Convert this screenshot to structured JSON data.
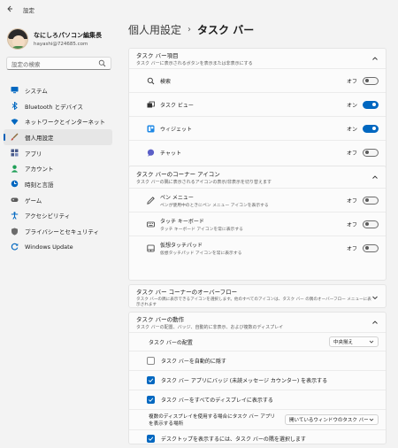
{
  "window": {
    "title": "設定",
    "back_icon": "back-arrow-icon"
  },
  "profile": {
    "name": "なにしろパソコン編集長",
    "email": "hayashi@724685.com"
  },
  "search": {
    "placeholder": "設定の検索",
    "icon": "search-icon"
  },
  "sidebar": {
    "items": [
      {
        "label": "システム",
        "icon": "monitor-icon",
        "color": "#0067c0",
        "active": false
      },
      {
        "label": "Bluetooth とデバイス",
        "icon": "bluetooth-icon",
        "color": "#0067c0",
        "active": false
      },
      {
        "label": "ネットワークとインターネット",
        "icon": "wifi-icon",
        "color": "#0067c0",
        "active": false
      },
      {
        "label": "個人用設定",
        "icon": "brush-icon",
        "color": "#8a6b3c",
        "active": true
      },
      {
        "label": "アプリ",
        "icon": "apps-icon",
        "color": "#4a5b8a",
        "active": false
      },
      {
        "label": "アカウント",
        "icon": "person-icon",
        "color": "#1f9f57",
        "active": false
      },
      {
        "label": "時刻と言語",
        "icon": "globe-clock-icon",
        "color": "#0067c0",
        "active": false
      },
      {
        "label": "ゲーム",
        "icon": "gamepad-icon",
        "color": "#5a5a5a",
        "active": false
      },
      {
        "label": "アクセシビリティ",
        "icon": "accessibility-icon",
        "color": "#0067c0",
        "active": false
      },
      {
        "label": "プライバシーとセキュリティ",
        "icon": "shield-icon",
        "color": "#6b6b6b",
        "active": false
      },
      {
        "label": "Windows Update",
        "icon": "update-icon",
        "color": "#0067c0",
        "active": false
      }
    ]
  },
  "breadcrumb": {
    "parent": "個人用設定",
    "separator": "›",
    "current": "タスク バー"
  },
  "sections": {
    "items": {
      "title": "タスク バー項目",
      "subtitle": "タスク バーに表示されるボタンを表示または非表示にする",
      "rows": [
        {
          "label": "検索",
          "icon": "search-icon",
          "state": "オフ",
          "on": false
        },
        {
          "label": "タスク ビュー",
          "icon": "task-view-icon",
          "state": "オン",
          "on": true
        },
        {
          "label": "ウィジェット",
          "icon": "widgets-icon",
          "state": "オン",
          "on": true
        },
        {
          "label": "チャット",
          "icon": "chat-icon",
          "state": "オフ",
          "on": false
        }
      ]
    },
    "corner": {
      "title": "タスク バーのコーナー アイコン",
      "subtitle": "タスク バーの隅に表示されるアイコンの表示/非表示を切り替えます",
      "rows": [
        {
          "label": "ペン メニュー",
          "sub": "ペンが使用中のときにペン メニュー アイコンを表示する",
          "icon": "pen-icon",
          "state": "オフ",
          "on": false
        },
        {
          "label": "タッチ キーボード",
          "sub": "タッチ キーボード アイコンを常に表示する",
          "icon": "keyboard-icon",
          "state": "オフ",
          "on": false
        },
        {
          "label": "仮想タッチパッド",
          "sub": "仮想タッチパッド アイコンを常に表示する",
          "icon": "touchpad-icon",
          "state": "オフ",
          "on": false
        }
      ]
    },
    "overflow": {
      "title": "タスク バー コーナーのオーバーフロー",
      "subtitle": "タスク バーの隅に表示できるアイコンを選択します。他のすべてのアイコンは、タスク バー の隅のオーバーフロー メニューに表示されます"
    },
    "behavior": {
      "title": "タスク バーの動作",
      "subtitle": "タスク バーの配置、バッジ、自動的に非表示、および複数のディスプレイ",
      "alignment_label": "タスク バーの配置",
      "alignment_value": "中央揃え",
      "checks": [
        {
          "label": "タスク バーを自動的に隠す",
          "checked": false
        },
        {
          "label": "タスク バー アプリにバッジ (未読メッセージ カウンター) を表示する",
          "checked": true
        },
        {
          "label": "タスク バーをすべてのディスプレイに表示する",
          "checked": true
        }
      ],
      "multi_label_1": "複数のディスプレイを使用する場合にタスク バー アプリ",
      "multi_label_2": "を表示する場所",
      "multi_value": "開いているウィンドウのタスク バー",
      "last_check": {
        "label": "デスクトップを表示するには、タスク バーの隅を選択します",
        "checked": true
      }
    }
  },
  "colors": {
    "accent": "#0067c0",
    "background": "#f3f3f3",
    "card": "#fbfbfb"
  }
}
